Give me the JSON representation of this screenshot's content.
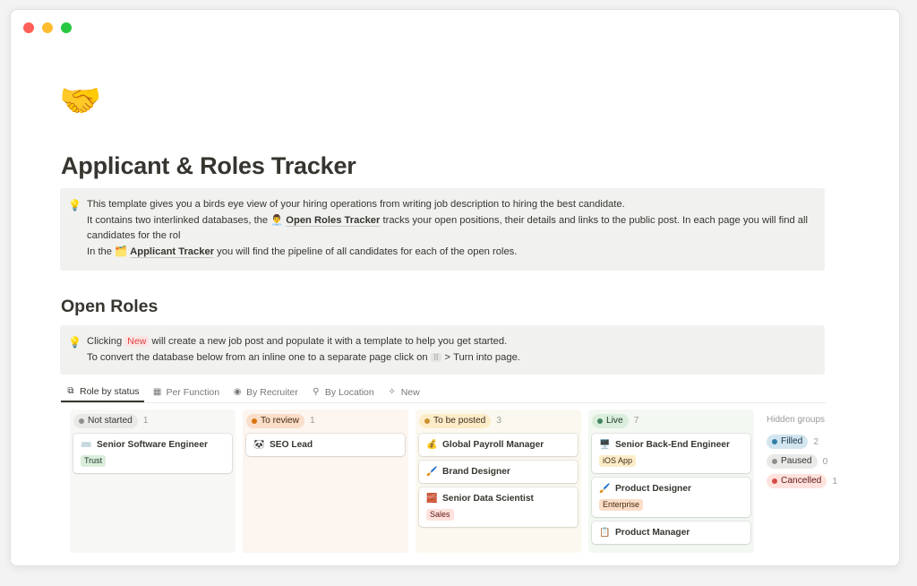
{
  "page": {
    "icon": "🤝",
    "title": "Applicant & Roles Tracker"
  },
  "callout1": {
    "icon": "💡",
    "line1": "This template gives you a birds eye view of your hiring operations from writing job description to hiring the best candidate.",
    "line2_pre": "It contains two interlinked databases, the ",
    "line2_link_icon": "👨‍💼",
    "line2_link": "Open Roles Tracker",
    "line2_post": " tracks your open positions, their details and links to the public post. In each page you will find all candidates for the rol",
    "line3_pre": "In the ",
    "line3_link_icon": "🗂️",
    "line3_link": "Applicant Tracker",
    "line3_post": " you will find the pipeline of all candidates for each of the open roles."
  },
  "section": {
    "title": "Open Roles"
  },
  "callout2": {
    "icon": "💡",
    "line1_pre": "Clicking ",
    "line1_tag": "New",
    "line1_post": " will create a new job post and populate it with a template to help you get started.",
    "line2_pre": "To convert the database below from an inline one to a separate page click on ",
    "line2_btn": "⠿",
    "line2_post": " > Turn into page."
  },
  "tabs": [
    {
      "icon": "board-icon",
      "label": "Role by status"
    },
    {
      "icon": "table-icon",
      "label": "Per Function"
    },
    {
      "icon": "person-icon",
      "label": "By Recruiter"
    },
    {
      "icon": "pin-icon",
      "label": "By Location"
    },
    {
      "icon": "sparkle-icon",
      "label": "New"
    }
  ],
  "columns": [
    {
      "status": "Not started",
      "count": "1",
      "colors": {
        "bg": "#f7f7f5",
        "pill": "#e9e9e7",
        "dot": "#91918e",
        "text": "#37352f"
      },
      "cards": [
        {
          "emoji": "⌨️",
          "title": "Senior Software Engineer",
          "tag": "Trust",
          "tag_bg": "#dbeddb",
          "tag_color": "#1c3829"
        }
      ]
    },
    {
      "status": "To review",
      "count": "1",
      "colors": {
        "bg": "#fcf5f0",
        "pill": "#fadec9",
        "dot": "#d9730d",
        "text": "#49290e"
      },
      "cards": [
        {
          "emoji": "🐼",
          "title": "SEO Lead",
          "tag": "",
          "tag_bg": "",
          "tag_color": ""
        }
      ]
    },
    {
      "status": "To be posted",
      "count": "3",
      "colors": {
        "bg": "#fbf9ef",
        "pill": "#fdecc8",
        "dot": "#cb912f",
        "text": "#402c1b"
      },
      "cards": [
        {
          "emoji": "💰",
          "title": "Global Payroll Manager",
          "tag": "",
          "tag_bg": "",
          "tag_color": ""
        },
        {
          "emoji": "🖌️",
          "title": "Brand Designer",
          "tag": "",
          "tag_bg": "",
          "tag_color": ""
        },
        {
          "emoji": "🧱",
          "title": "Senior Data Scientist",
          "tag": "Sales",
          "tag_bg": "#ffe2dd",
          "tag_color": "#5d1715"
        }
      ]
    },
    {
      "status": "Live",
      "count": "7",
      "colors": {
        "bg": "#f4f8f3",
        "pill": "#dbeddb",
        "dot": "#448361",
        "text": "#1c3829"
      },
      "cards": [
        {
          "emoji": "🖥️",
          "title": "Senior Back-End Engineer",
          "tag": "iOS App",
          "tag_bg": "#fdecc8",
          "tag_color": "#402c1b"
        },
        {
          "emoji": "🖌️",
          "title": "Product Designer",
          "tag": "Enterprise",
          "tag_bg": "#fadec9",
          "tag_color": "#49290e"
        },
        {
          "emoji": "📋",
          "title": "Product Manager",
          "tag": "",
          "tag_bg": "",
          "tag_color": ""
        }
      ]
    }
  ],
  "hidden_groups": {
    "title": "Hidden groups",
    "items": [
      {
        "label": "Filled",
        "count": "2",
        "pill": "#d3e5ef",
        "dot": "#337ea9",
        "text": "#183347"
      },
      {
        "label": "Paused",
        "count": "0",
        "pill": "#e9e9e7",
        "dot": "#91918e",
        "text": "#37352f"
      },
      {
        "label": "Cancelled",
        "count": "1",
        "pill": "#ffe2dd",
        "dot": "#d44c47",
        "text": "#5d1715"
      }
    ]
  }
}
